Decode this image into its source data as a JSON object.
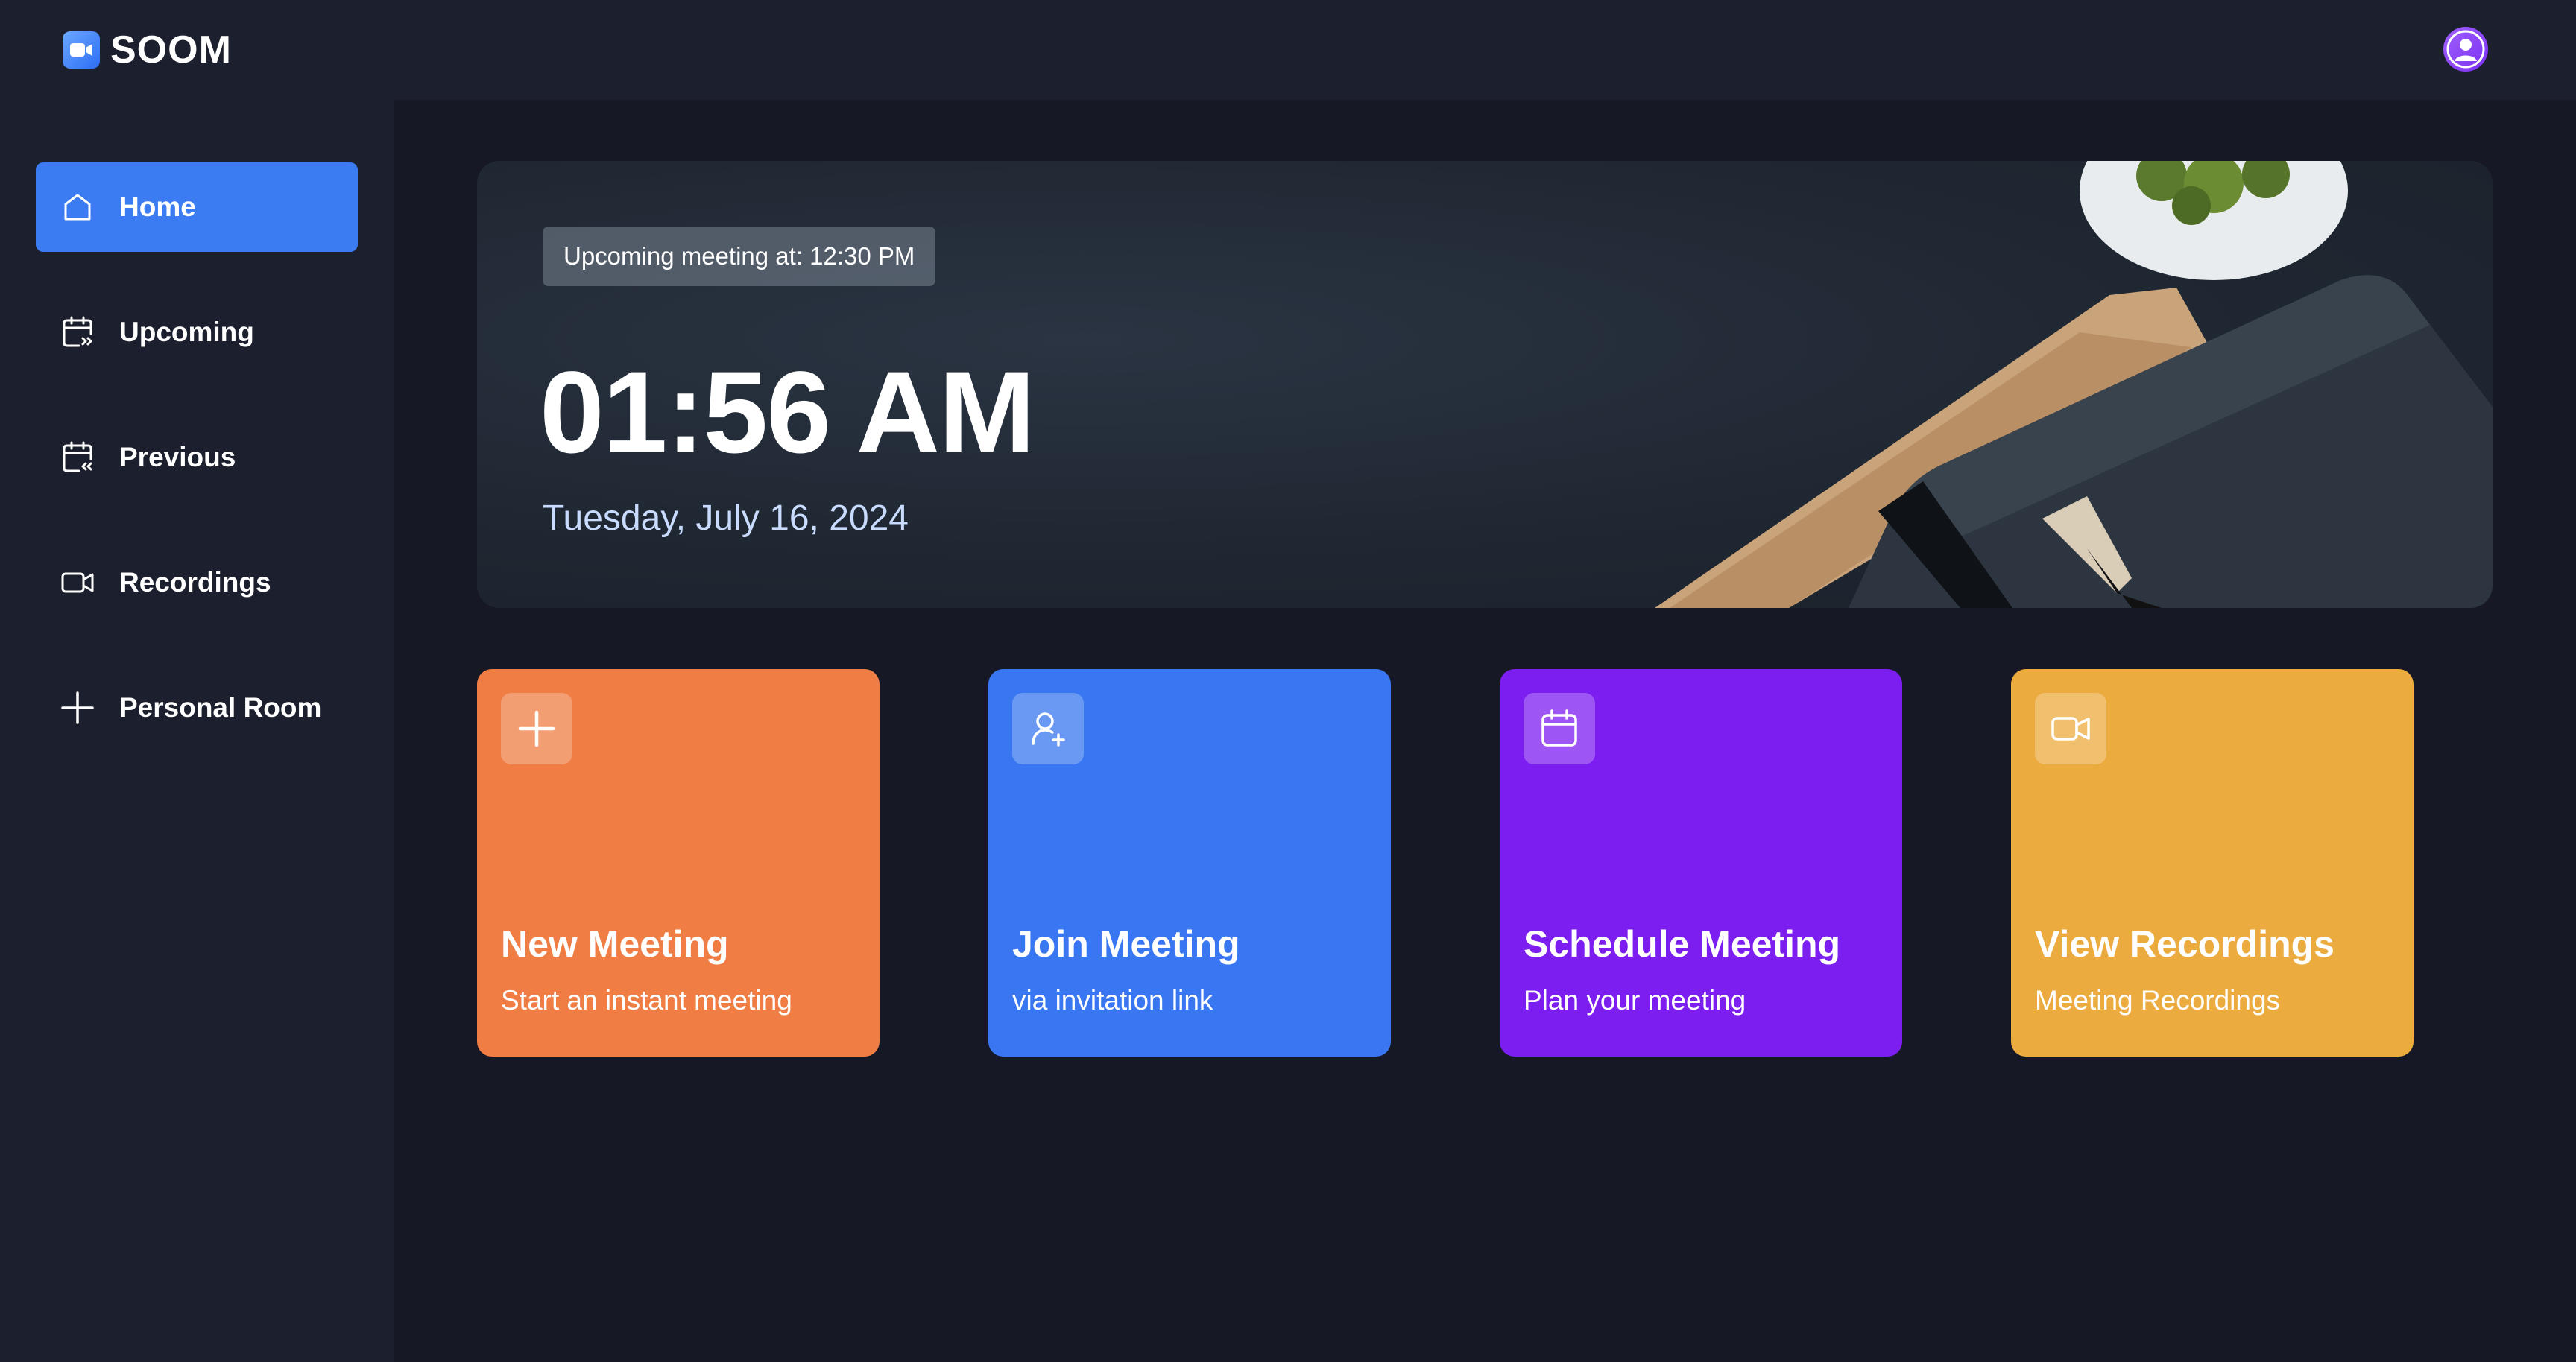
{
  "app": {
    "name": "SOOM"
  },
  "colors": {
    "accent": "#3b7cf3",
    "background": "#1c1f2e",
    "main_background": "#161925",
    "card_orange": "#ef7d44",
    "card_blue": "#3877f1",
    "card_purple": "#7c1ef0",
    "card_yellow": "#ecab3e"
  },
  "sidebar": {
    "items": [
      {
        "label": "Home",
        "icon": "home-icon",
        "active": true
      },
      {
        "label": "Upcoming",
        "icon": "calendar-upcoming-icon",
        "active": false
      },
      {
        "label": "Previous",
        "icon": "calendar-previous-icon",
        "active": false
      },
      {
        "label": "Recordings",
        "icon": "video-icon",
        "active": false
      },
      {
        "label": "Personal Room",
        "icon": "plus-icon",
        "active": false
      }
    ]
  },
  "hero": {
    "badge": "Upcoming meeting at: 12:30 PM",
    "time": "01:56 AM",
    "date": "Tuesday, July 16, 2024"
  },
  "cards": [
    {
      "title": "New Meeting",
      "subtitle": "Start an instant meeting",
      "icon": "plus-icon",
      "color": "#ef7d44"
    },
    {
      "title": "Join Meeting",
      "subtitle": "via invitation link",
      "icon": "add-user-icon",
      "color": "#3877f1"
    },
    {
      "title": "Schedule Meeting",
      "subtitle": "Plan your meeting",
      "icon": "calendar-icon",
      "color": "#7c1ef0"
    },
    {
      "title": "View Recordings",
      "subtitle": "Meeting Recordings",
      "icon": "video-icon",
      "color": "#ecab3e"
    }
  ]
}
